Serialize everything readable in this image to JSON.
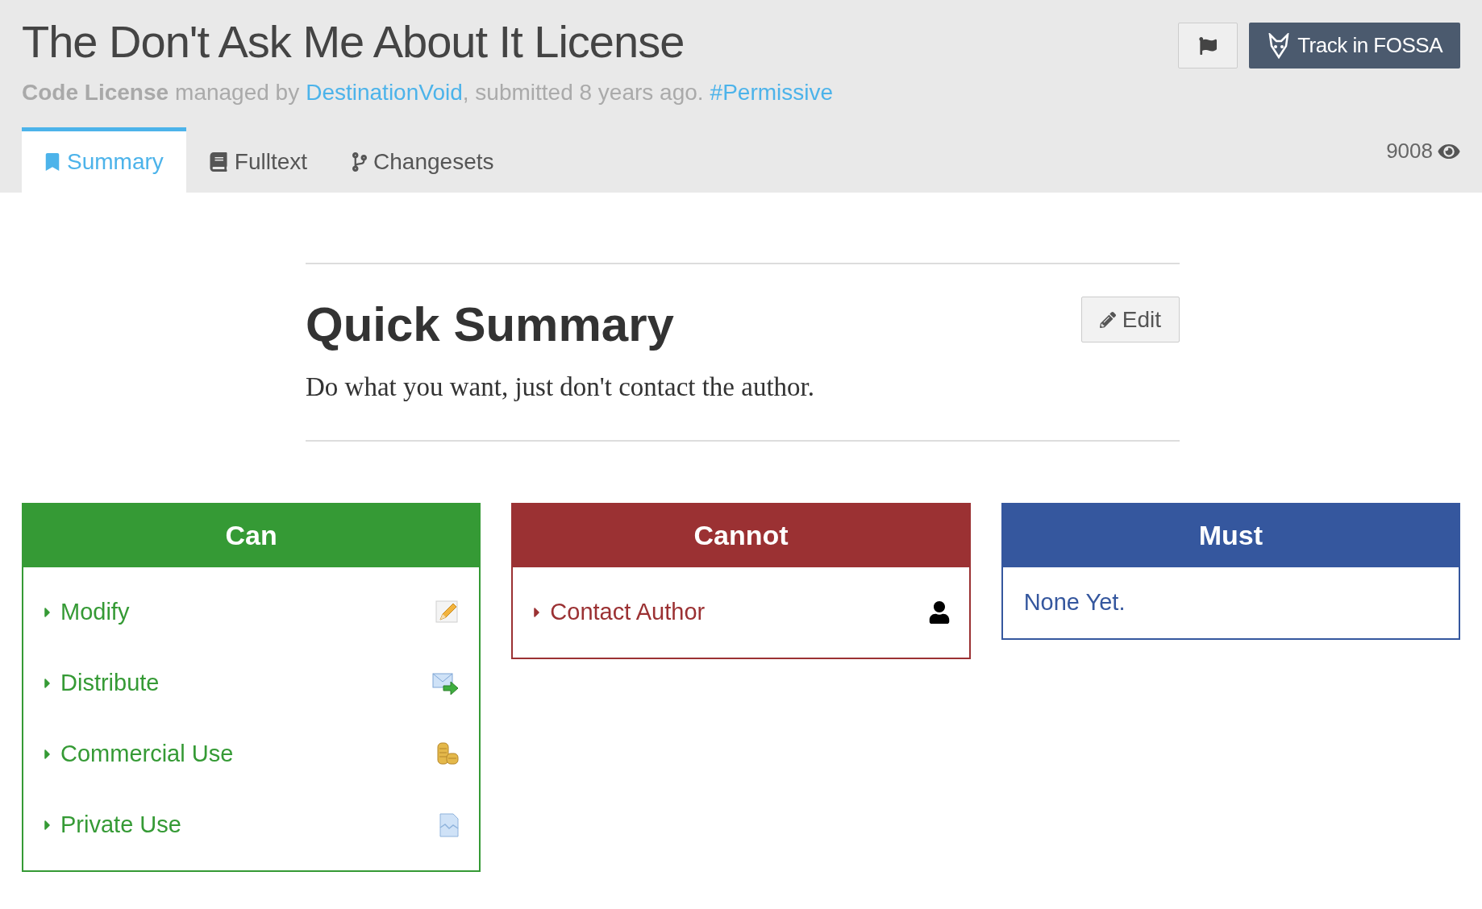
{
  "header": {
    "title": "The Don't Ask Me About It License",
    "subtitle": {
      "category": "Code License",
      "managed_by": "managed by",
      "author": "DestinationVoid",
      "submitted": ", submitted 8 years ago.",
      "tag": "#Permissive"
    },
    "track_button": "Track in FOSSA",
    "views": "9008",
    "tabs": [
      {
        "label": "Summary",
        "kind": "bookmark",
        "selected": true
      },
      {
        "label": "Fulltext",
        "kind": "book",
        "selected": false
      },
      {
        "label": "Changesets",
        "kind": "branch",
        "selected": false
      }
    ]
  },
  "summary": {
    "heading": "Quick Summary",
    "edit_button": "Edit",
    "description": "Do what you want, just don't contact the author."
  },
  "columns": [
    {
      "title": "Can",
      "color": "#359a35",
      "items": [
        {
          "label": "Modify",
          "kind": "pencil"
        },
        {
          "label": "Distribute",
          "kind": "envelope"
        },
        {
          "label": "Commercial Use",
          "kind": "coins"
        },
        {
          "label": "Private Use",
          "kind": "document"
        }
      ]
    },
    {
      "title": "Cannot",
      "color": "#9b3133",
      "items": [
        {
          "label": "Contact Author",
          "kind": "person"
        }
      ]
    },
    {
      "title": "Must",
      "color": "#35579e",
      "empty_text": "None Yet."
    }
  ]
}
